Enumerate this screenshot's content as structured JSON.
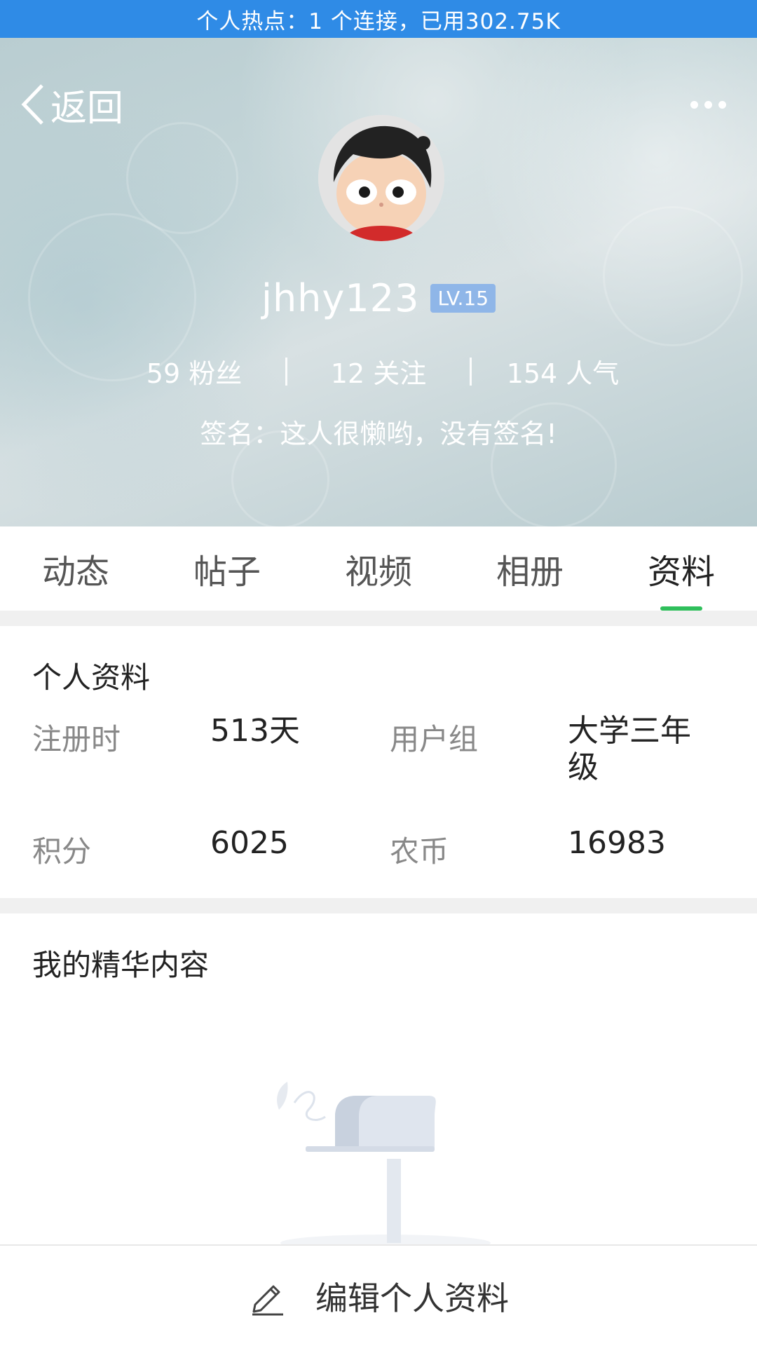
{
  "status_bar": {
    "text": "个人热点：1 个连接，已用302.75K"
  },
  "header": {
    "back_label": "返回",
    "more_icon": "more-dots-icon",
    "username": "jhhy123",
    "level": "LV.15",
    "stats": {
      "fans": "59 粉丝",
      "following": "12 关注",
      "popularity": "154 人气"
    },
    "signature": "签名：这人很懒哟，没有签名!"
  },
  "tabs": [
    {
      "label": "动态"
    },
    {
      "label": "帖子"
    },
    {
      "label": "视频"
    },
    {
      "label": "相册"
    },
    {
      "label": "资料"
    }
  ],
  "active_tab": "资料",
  "profile": {
    "title": "个人资料",
    "fields": [
      {
        "label": "注册时",
        "value": "513天"
      },
      {
        "label": "用户组",
        "value": "大学三年级"
      },
      {
        "label": "积分",
        "value": "6025"
      },
      {
        "label": "农币",
        "value": "16983"
      }
    ]
  },
  "featured": {
    "title": "我的精华内容"
  },
  "bottom": {
    "edit_label": "编辑个人资料",
    "edit_icon": "pencil-icon"
  },
  "colors": {
    "status_bar": "#2f8be6",
    "active_indicator": "#2fbf5b",
    "level_badge": "#8fb6e8"
  }
}
